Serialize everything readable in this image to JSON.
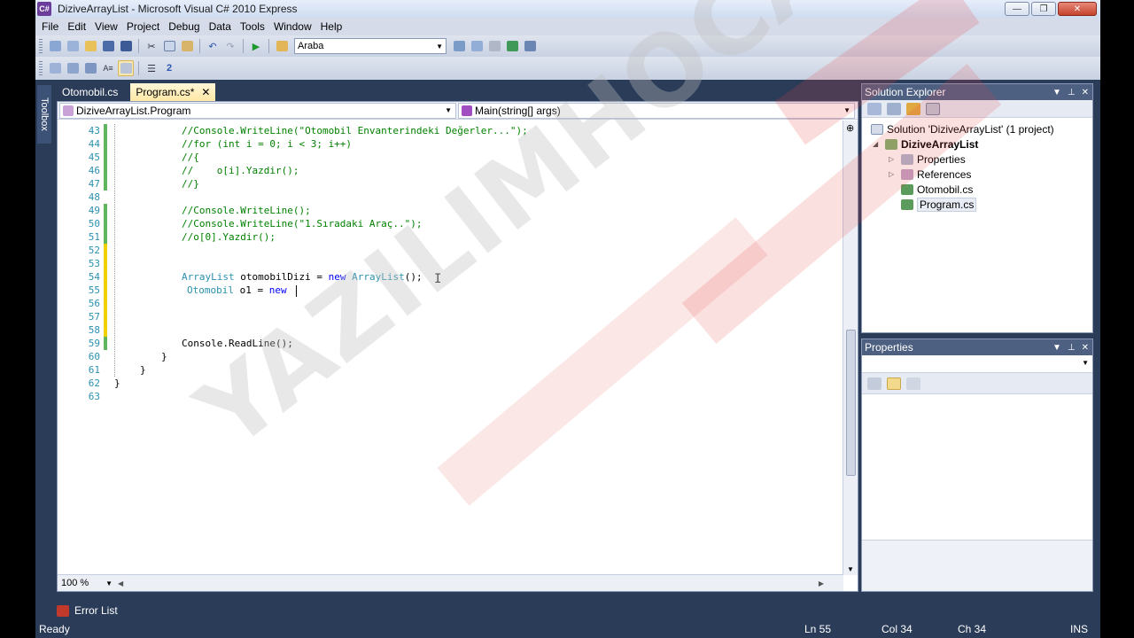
{
  "window": {
    "title": "DiziveArrayList - Microsoft Visual C# 2010 Express",
    "app_icon": "C#"
  },
  "menu": [
    "File",
    "Edit",
    "View",
    "Project",
    "Debug",
    "Data",
    "Tools",
    "Window",
    "Help"
  ],
  "toolbar": {
    "config_combo": "Araba"
  },
  "toolbox_label": "Toolbox",
  "tabs": [
    {
      "label": "Otomobil.cs",
      "active": false
    },
    {
      "label": "Program.cs*",
      "active": true
    }
  ],
  "navbar": {
    "type_combo": "DiziveArrayList.Program",
    "member_combo": "Main(string[] args)"
  },
  "line_numbers": [
    "43",
    "44",
    "45",
    "46",
    "47",
    "48",
    "49",
    "50",
    "51",
    "52",
    "53",
    "54",
    "55",
    "56",
    "57",
    "58",
    "59",
    "60",
    "61",
    "62",
    "63"
  ],
  "code_lines": [
    "//Console.WriteLine(\"Otomobil Envanterindeki Değerler...\");",
    "//for (int i = 0; i < 3; i++)",
    "//{",
    "//    o[i].Yazdir();",
    "//}",
    "",
    "//Console.WriteLine();",
    "//Console.WriteLine(\"1.Sıradaki Araç..\");",
    "//o[0].Yazdir();",
    "",
    "",
    "ArrayList otomobilDizi = new ArrayList();",
    "Otomobil o1 = new",
    "",
    "",
    "",
    "Console.ReadLine();",
    "}",
    "}",
    "}",
    ""
  ],
  "editor": {
    "zoom": "100 %"
  },
  "solution_explorer": {
    "title": "Solution Explorer",
    "solution": "Solution 'DiziveArrayList' (1 project)",
    "project": "DiziveArrayList",
    "items": [
      "Properties",
      "References",
      "Otomobil.cs",
      "Program.cs"
    ]
  },
  "properties_panel": {
    "title": "Properties"
  },
  "error_list": "Error List",
  "status": {
    "state": "Ready",
    "line": "Ln 55",
    "col": "Col 34",
    "ch": "Ch 34",
    "mode": "INS"
  },
  "watermark": "YAZILIMHOCASI.CO",
  "colors": {
    "chrome": "#2b3c59",
    "active_tab": "#ffe8a6",
    "comment": "#008000",
    "keyword": "#0000ff",
    "type": "#2b91af"
  }
}
